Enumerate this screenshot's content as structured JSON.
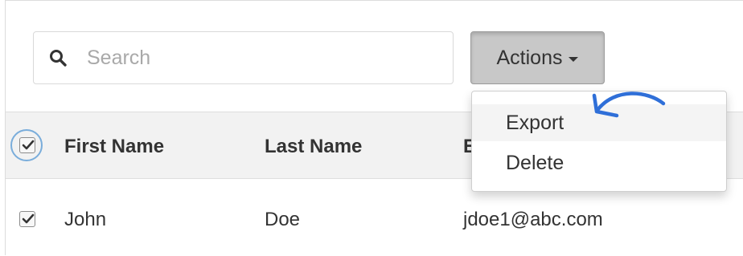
{
  "search": {
    "placeholder": "Search",
    "value": ""
  },
  "actions": {
    "label": "Actions",
    "menu_items": [
      {
        "label": "Export"
      },
      {
        "label": "Delete"
      }
    ]
  },
  "table": {
    "columns": [
      "First Name",
      "Last Name",
      "E"
    ],
    "header_checkbox_checked": true,
    "rows": [
      {
        "checked": true,
        "first_name": "John",
        "last_name": "Doe",
        "email": "jdoe1@abc.com"
      }
    ]
  },
  "colors": {
    "annotation": "#2f6fd8",
    "header_bg": "#f2f2f2",
    "button_active_bg": "#c8c8c8"
  }
}
